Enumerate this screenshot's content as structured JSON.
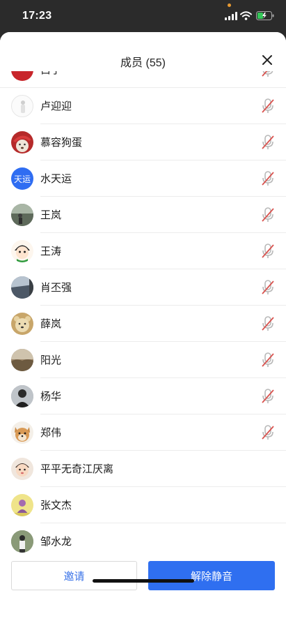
{
  "status_bar": {
    "time": "17:23"
  },
  "sheet": {
    "title": "成员 (55)",
    "partial_name": "白子"
  },
  "members": [
    {
      "name": "卢迎迎",
      "muted": true,
      "avatar": "photo-white-figure"
    },
    {
      "name": "慕容狗蛋",
      "muted": true,
      "avatar": "photo-dog-red"
    },
    {
      "name": "水天运",
      "muted": true,
      "avatar_text": "天运",
      "avatar_color": "#2f6df2"
    },
    {
      "name": "王岚",
      "muted": true,
      "avatar": "photo-road"
    },
    {
      "name": "王涛",
      "muted": true,
      "avatar": "photo-cartoon"
    },
    {
      "name": "肖丕强",
      "muted": true,
      "avatar": "photo-lake"
    },
    {
      "name": "薛岚",
      "muted": true,
      "avatar": "photo-bear"
    },
    {
      "name": "阳光",
      "muted": true,
      "avatar": "photo-landscape"
    },
    {
      "name": "杨华",
      "muted": true,
      "avatar": "photo-person-dark"
    },
    {
      "name": "郑伟",
      "muted": true,
      "avatar": "photo-puppy"
    },
    {
      "name": "平平无奇江厌离",
      "muted": false,
      "avatar": "photo-baby"
    },
    {
      "name": "张文杰",
      "muted": false,
      "avatar": "photo-yellow"
    },
    {
      "name": "邹水龙",
      "muted": false,
      "avatar": "photo-person-outdoor"
    }
  ],
  "buttons": {
    "invite": "邀请",
    "unmute_all": "解除静音"
  },
  "colors": {
    "accent": "#2f6ff0",
    "muted_mic": "#d9534f"
  }
}
